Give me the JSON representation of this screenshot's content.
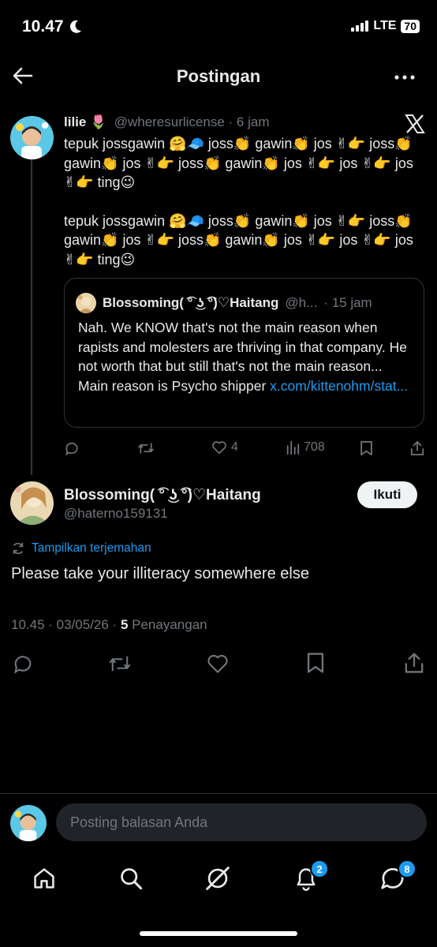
{
  "status_bar": {
    "time": "10.47",
    "network": "LTE",
    "battery": "70"
  },
  "header": {
    "title": "Postingan"
  },
  "parent_tweet": {
    "name": "lilie 🌷",
    "handle": "@wheresurlicense",
    "time": "· 6 jam",
    "paragraphs": [
      "tepuk jossgawin 🤗🧢 joss👏 gawin👏 jos ✌👉 joss👏 gawin👏 jos ✌👉 joss👏 gawin👏 jos ✌👉 jos ✌👉 jos ✌👉 ting😉",
      "tepuk jossgawin 🤗🧢 joss👏 gawin👏 jos ✌👉 joss👏 gawin👏 jos ✌👉 joss👏 gawin👏 jos ✌👉 jos ✌👉 jos ✌👉 ting😉"
    ],
    "quote": {
      "name": "Blossoming(  ͡° ͜ʖ ͡°)♡Haitang",
      "handle": "@h...",
      "time": "· 15 jam",
      "text": "Nah. We KNOW that's not the main reason when rapists and molesters are thriving in that company. He not worth that but still that's not the main reason... Main reason is Psycho shipper ",
      "link": "x.com/kittenohm/stat..."
    },
    "actions": {
      "likes": "4",
      "views": "708"
    }
  },
  "main_tweet": {
    "name": "Blossoming(  ͡° ͜ʖ ͡°)♡Haitang",
    "handle": "@haterno159131",
    "follow_label": "Ikuti",
    "translate_label": "Tampilkan terjemahan",
    "text": "Please take your illiteracy somewhere else",
    "timestamp": "10.45 · 03/05/26 · ",
    "views_count": "5",
    "views_label": " Penayangan"
  },
  "reply_bar": {
    "placeholder": "Posting balasan Anda"
  },
  "bottom_nav": {
    "notifications_badge": "2",
    "messages_badge": "8"
  },
  "colors": {
    "accent": "#1d9bf0",
    "background": "#000000",
    "muted": "#71767b"
  }
}
